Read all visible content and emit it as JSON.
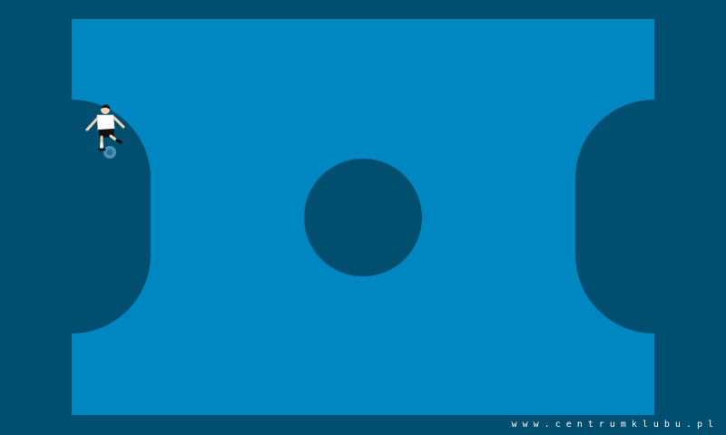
{
  "colors": {
    "outer": "#004e70",
    "pitch": "#0086c0",
    "shirt": "#ffffff",
    "shorts": "#111111",
    "skin": "#f4d3b4",
    "ball": "#4b90b6"
  },
  "game": {
    "field": "futsal-pitch",
    "player": {
      "icon": "soccer-player-icon",
      "kit": "white-shirt-black-shorts"
    }
  },
  "footer": {
    "watermark": "www.centrumklubu.pl"
  }
}
